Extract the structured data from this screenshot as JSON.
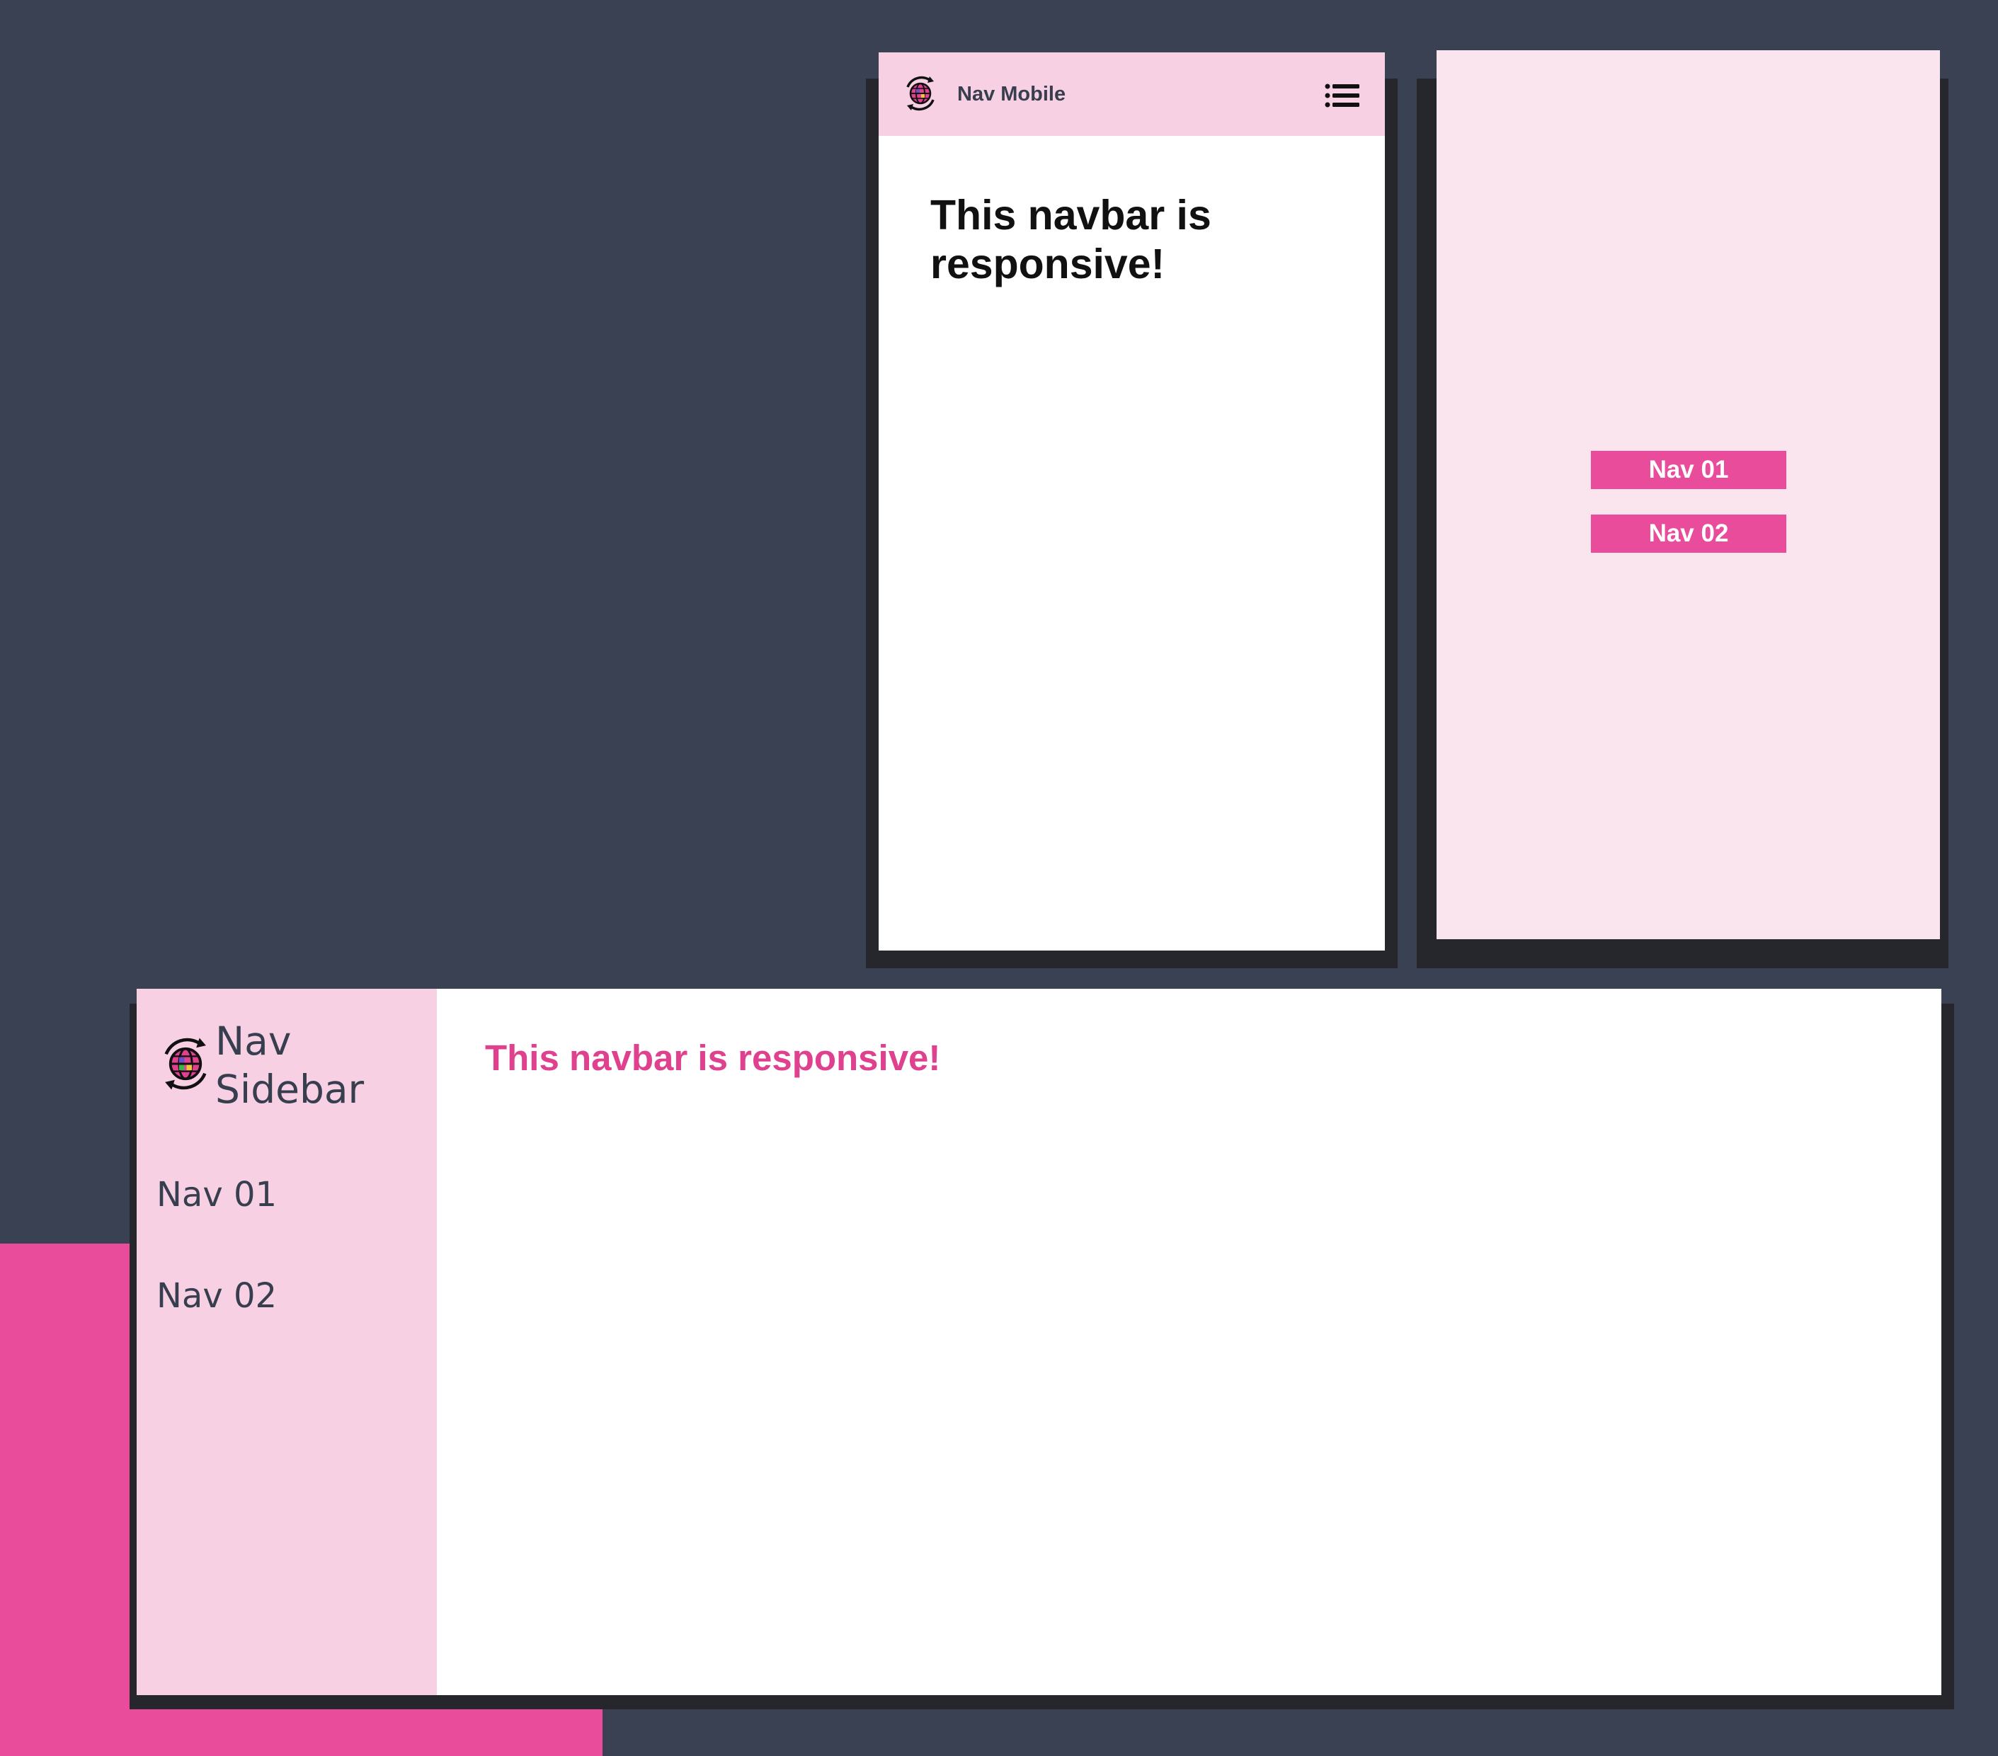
{
  "mobile": {
    "brand": "Nav Mobile",
    "heading": "This navbar is responsive!",
    "menu_icon": "list-menu-icon",
    "logo_icon": "globe-sync-icon"
  },
  "menu": {
    "items": [
      {
        "label": "Nav 01"
      },
      {
        "label": "Nav 02"
      }
    ]
  },
  "sidebar": {
    "brand_line1": "Nav",
    "brand_line2": "Sidebar",
    "logo_icon": "globe-sync-icon",
    "items": [
      {
        "label": "Nav 01"
      },
      {
        "label": "Nav 02"
      }
    ],
    "heading": "This navbar is responsive!"
  },
  "colors": {
    "background": "#394152",
    "accent_pink": "#ea4c9c",
    "light_pink": "#f8d0e4",
    "pale_pink": "#fae5ef",
    "text_dark": "#373e4e",
    "shadow": "#25272c"
  }
}
